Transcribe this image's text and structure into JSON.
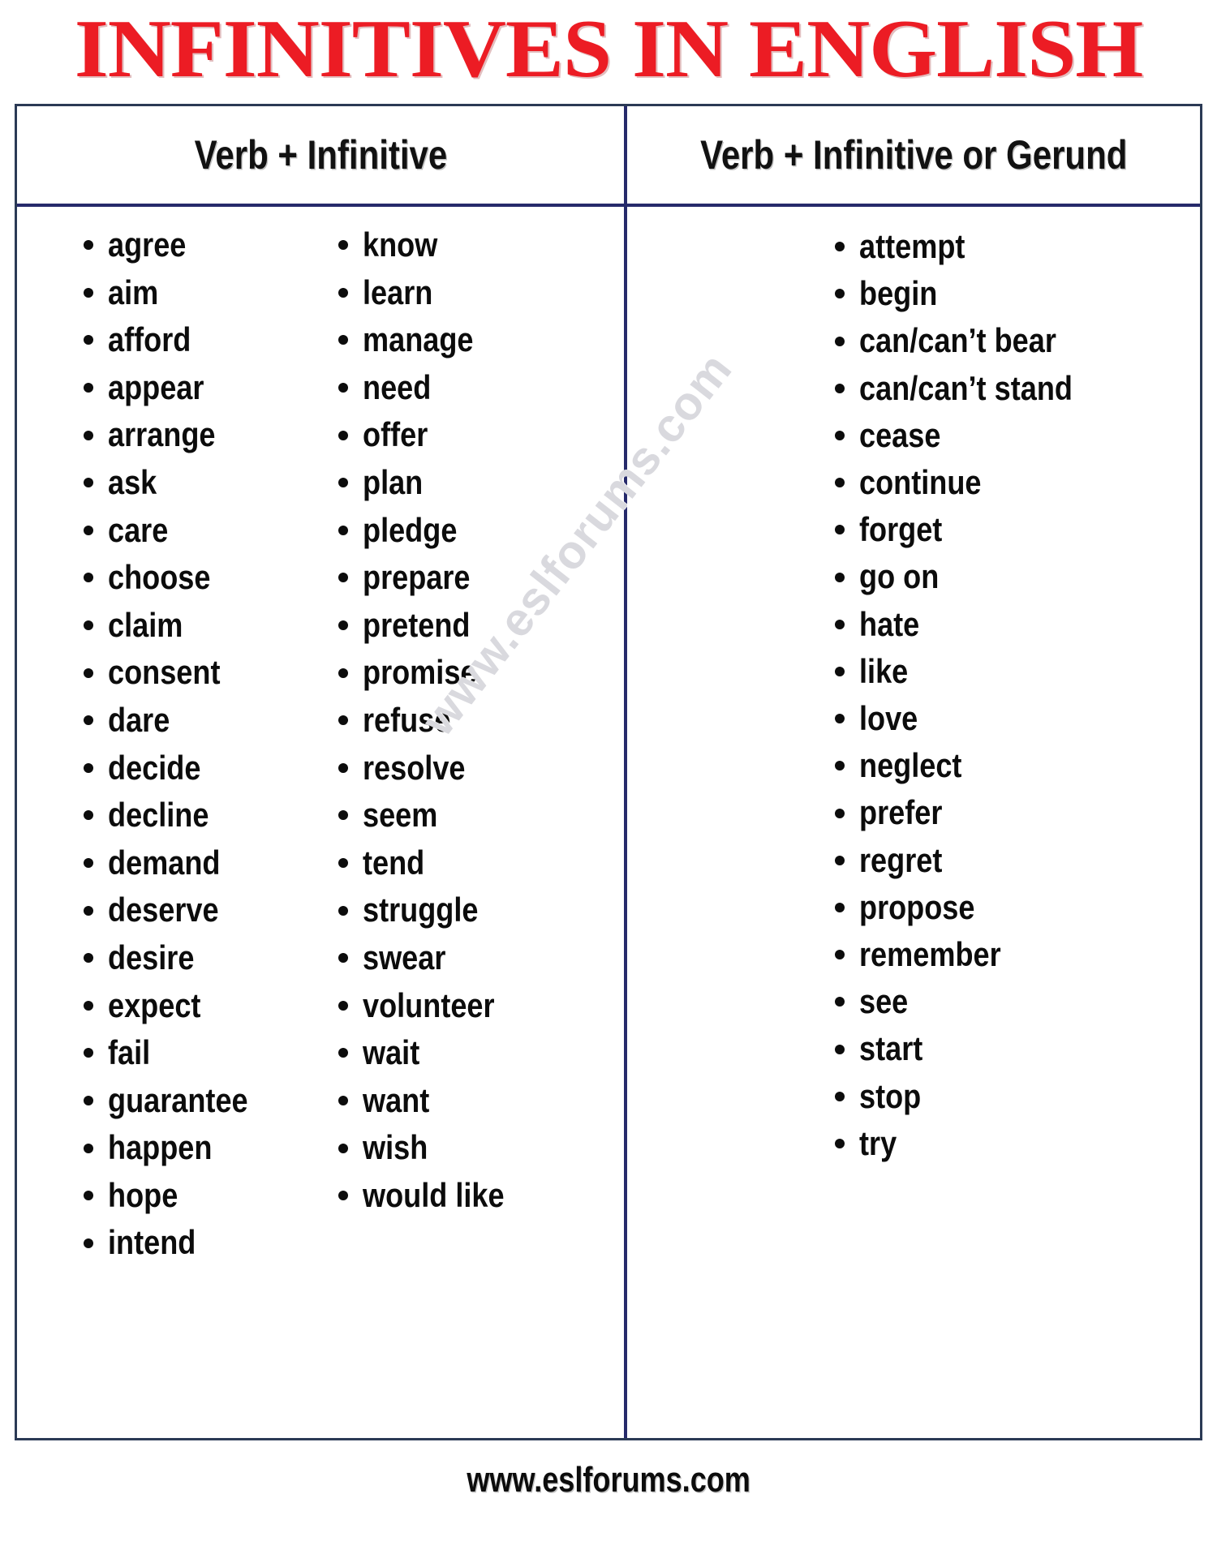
{
  "title": "INFINITIVES IN ENGLISH",
  "title_color": "#EC1C24",
  "border_color": "#262A6B",
  "text_color": "#0C0C0C",
  "watermark": "www.eslforums.com",
  "footer": "www.eslforums.com",
  "table": {
    "columns": [
      {
        "header": "Verb + Infinitive",
        "subcolumns": [
          [
            "agree",
            "aim",
            "afford",
            "appear",
            "arrange",
            "ask",
            "care",
            "choose",
            "claim",
            "consent",
            "dare",
            "decide",
            "decline",
            "demand",
            "deserve",
            "desire",
            "expect",
            "fail",
            "guarantee",
            "happen",
            "hope",
            "intend"
          ],
          [
            "know",
            "learn",
            "manage",
            "need",
            "offer",
            "plan",
            "pledge",
            "prepare",
            "pretend",
            "promise",
            "refuse",
            "resolve",
            "seem",
            "tend",
            "struggle",
            "swear",
            "volunteer",
            "wait",
            "want",
            "wish",
            "would like"
          ]
        ]
      },
      {
        "header": "Verb + Infinitive or Gerund",
        "subcolumns": [
          [
            "attempt",
            "begin",
            "can/can’t bear",
            "can/can’t stand",
            "cease",
            "continue",
            "forget",
            "go on",
            "hate",
            "like",
            "love",
            "neglect",
            "prefer",
            "regret",
            "propose",
            "remember",
            "see",
            "start",
            "stop",
            "try"
          ]
        ]
      }
    ]
  }
}
